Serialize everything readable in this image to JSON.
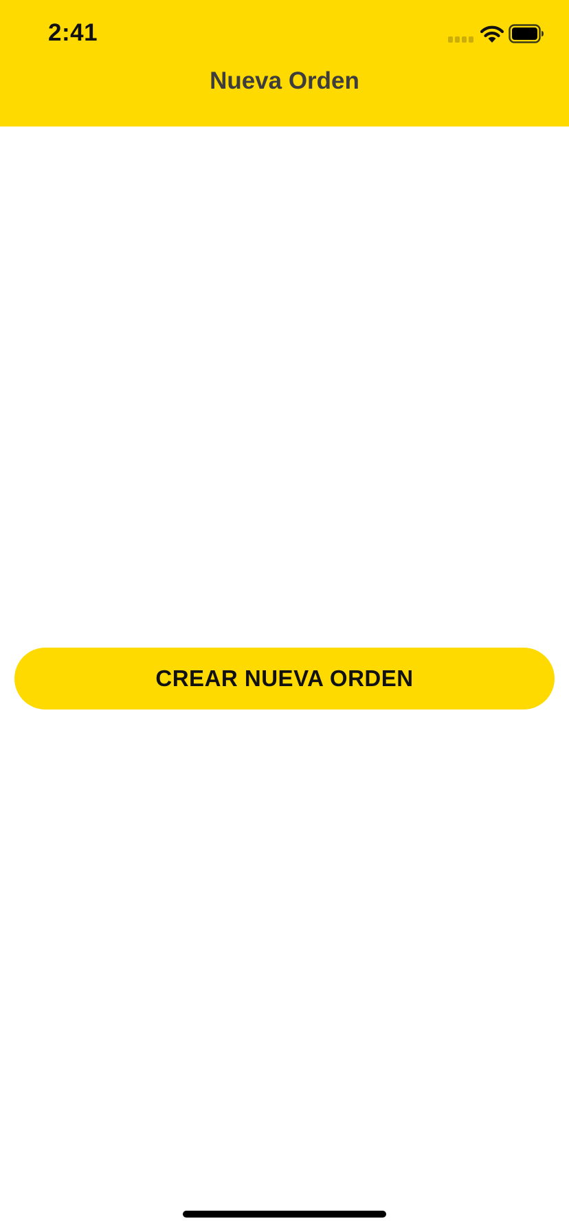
{
  "status_bar": {
    "time": "2:41",
    "signal_icon": "cellular-signal-icon",
    "wifi_icon": "wifi-icon",
    "battery_icon": "battery-icon",
    "battery_level": 1.0
  },
  "nav_bar": {
    "title": "Nueva Orden"
  },
  "main": {
    "create_button_label": "CREAR NUEVA ORDEN"
  },
  "colors": {
    "accent": "#FFDA00",
    "title_text": "#3D3D3D",
    "button_text": "#111111",
    "background": "#FFFFFF"
  }
}
